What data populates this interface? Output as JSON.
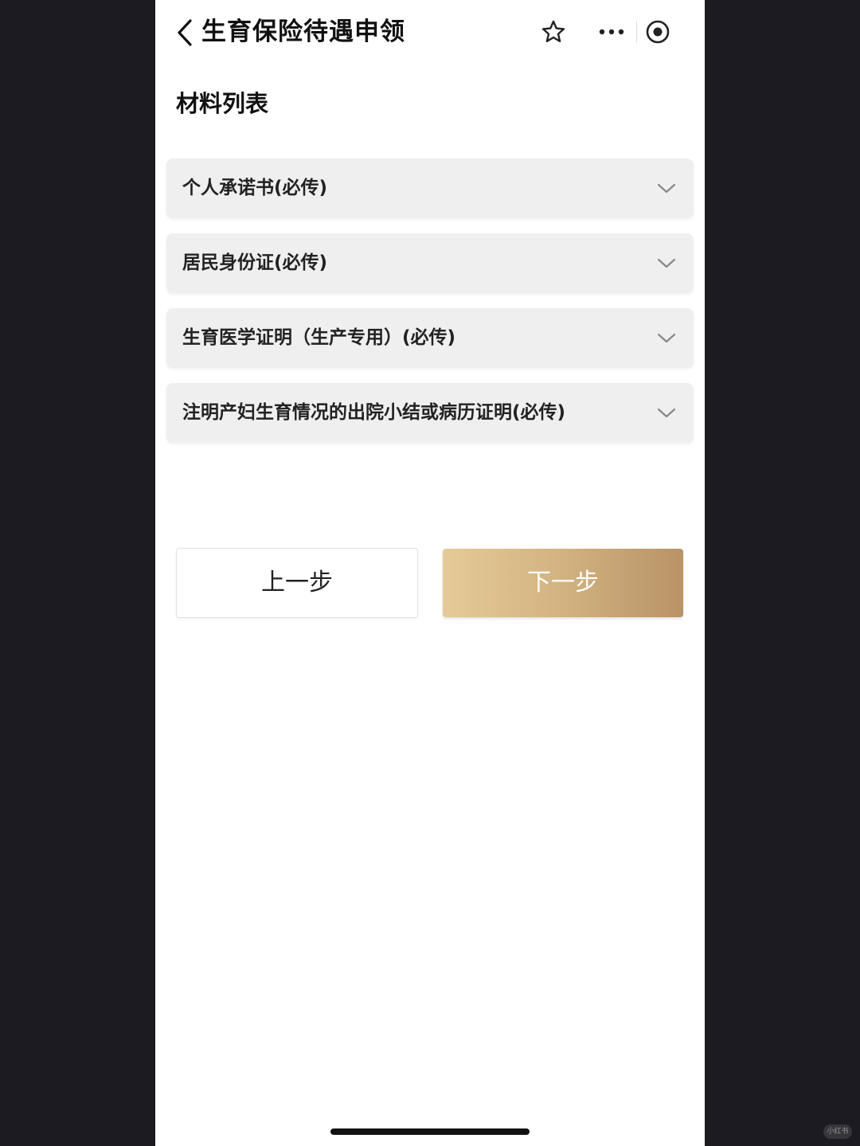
{
  "header": {
    "title": "生育保险待遇申领",
    "icons": [
      "back-icon",
      "star-icon",
      "more-icon",
      "target-icon"
    ]
  },
  "section": {
    "title": "材料列表"
  },
  "materials": [
    {
      "label": "个人承诺书(必传)"
    },
    {
      "label": "居民身份证(必传)"
    },
    {
      "label": "生育医学证明（生产专用）(必传)"
    },
    {
      "label": "注明产妇生育情况的出院小结或病历证明(必传)"
    }
  ],
  "actions": {
    "prev_label": "上一步",
    "next_label": "下一步"
  },
  "colors": {
    "accent_gradient_start": "#e5cb97",
    "accent_gradient_end": "#b89366",
    "item_background": "#efefef",
    "outer_background": "#1c1b21"
  },
  "watermark": {
    "text": "小红书"
  }
}
